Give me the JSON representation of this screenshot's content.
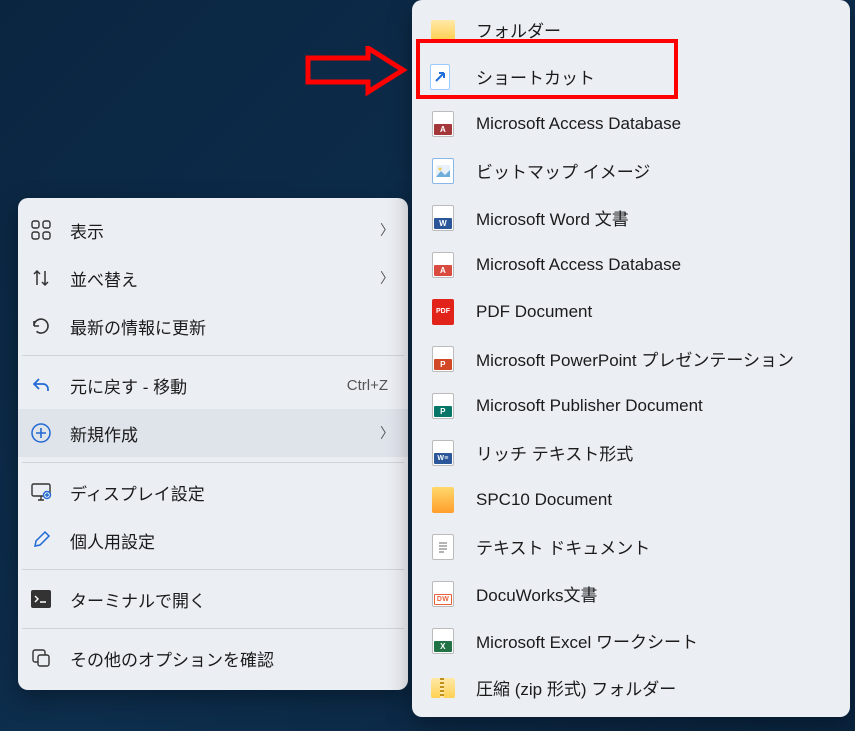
{
  "primaryMenu": {
    "items": [
      {
        "label": "表示",
        "hasSubmenu": true
      },
      {
        "label": "並べ替え",
        "hasSubmenu": true
      },
      {
        "label": "最新の情報に更新"
      },
      {
        "label": "元に戻す - 移動",
        "shortcut": "Ctrl+Z"
      },
      {
        "label": "新規作成",
        "hasSubmenu": true,
        "hover": true
      },
      {
        "label": "ディスプレイ設定"
      },
      {
        "label": "個人用設定"
      },
      {
        "label": "ターミナルで開く"
      },
      {
        "label": "その他のオプションを確認"
      }
    ]
  },
  "subMenu": {
    "items": [
      {
        "label": "フォルダー",
        "icon": "folder"
      },
      {
        "label": "ショートカット",
        "icon": "shortcut",
        "highlighted": true
      },
      {
        "label": "Microsoft Access Database",
        "icon": "access"
      },
      {
        "label": "ビットマップ イメージ",
        "icon": "bitmap"
      },
      {
        "label": "Microsoft Word 文書",
        "icon": "word"
      },
      {
        "label": "Microsoft Access Database",
        "icon": "access-red"
      },
      {
        "label": "PDF Document",
        "icon": "pdf"
      },
      {
        "label": "Microsoft PowerPoint プレゼンテーション",
        "icon": "powerpoint"
      },
      {
        "label": "Microsoft Publisher Document",
        "icon": "publisher"
      },
      {
        "label": "リッチ テキスト形式",
        "icon": "rtf"
      },
      {
        "label": "SPC10 Document",
        "icon": "spc10"
      },
      {
        "label": "テキスト ドキュメント",
        "icon": "text"
      },
      {
        "label": "DocuWorks文書",
        "icon": "docuworks"
      },
      {
        "label": "Microsoft Excel ワークシート",
        "icon": "excel"
      },
      {
        "label": "圧縮 (zip 形式) フォルダー",
        "icon": "zip"
      }
    ]
  },
  "annotation": {
    "highlightIndex": 1
  }
}
